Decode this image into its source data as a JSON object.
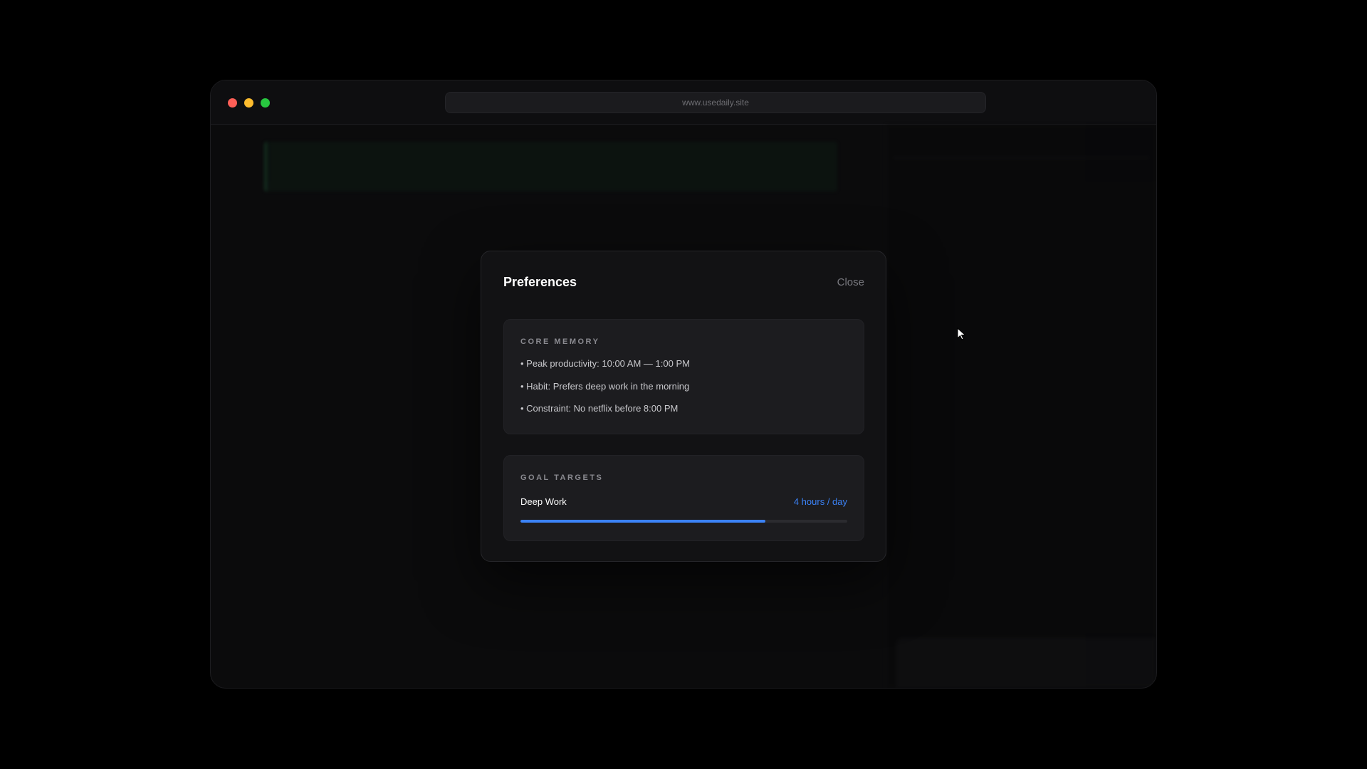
{
  "browser": {
    "url": "www.usedaily.site"
  },
  "background": {
    "time_labels": [
      "",
      "",
      "",
      "",
      "",
      "",
      "",
      "",
      "",
      ""
    ],
    "event": {
      "title": "",
      "subtitle": ""
    },
    "right_panel": {
      "header": "",
      "input_placeholder": ""
    }
  },
  "modal": {
    "title": "Preferences",
    "close_label": "Close",
    "core_memory": {
      "label": "CORE MEMORY",
      "items": [
        "• Peak productivity: 10:00 AM — 1:00 PM",
        "• Habit: Prefers deep work in the morning",
        "• Constraint: No netflix before 8:00 PM"
      ]
    },
    "goal_targets": {
      "label": "GOAL TARGETS",
      "goals": [
        {
          "name": "Deep Work",
          "target": "4 hours / day",
          "progress_fraction": 0.75
        }
      ]
    }
  },
  "colors": {
    "accent": "#3b82f6",
    "traffic_red": "#ff5f57",
    "traffic_yellow": "#febc2e",
    "traffic_green": "#28c840"
  },
  "icons": {
    "cursor": "arrow-cursor-icon"
  }
}
